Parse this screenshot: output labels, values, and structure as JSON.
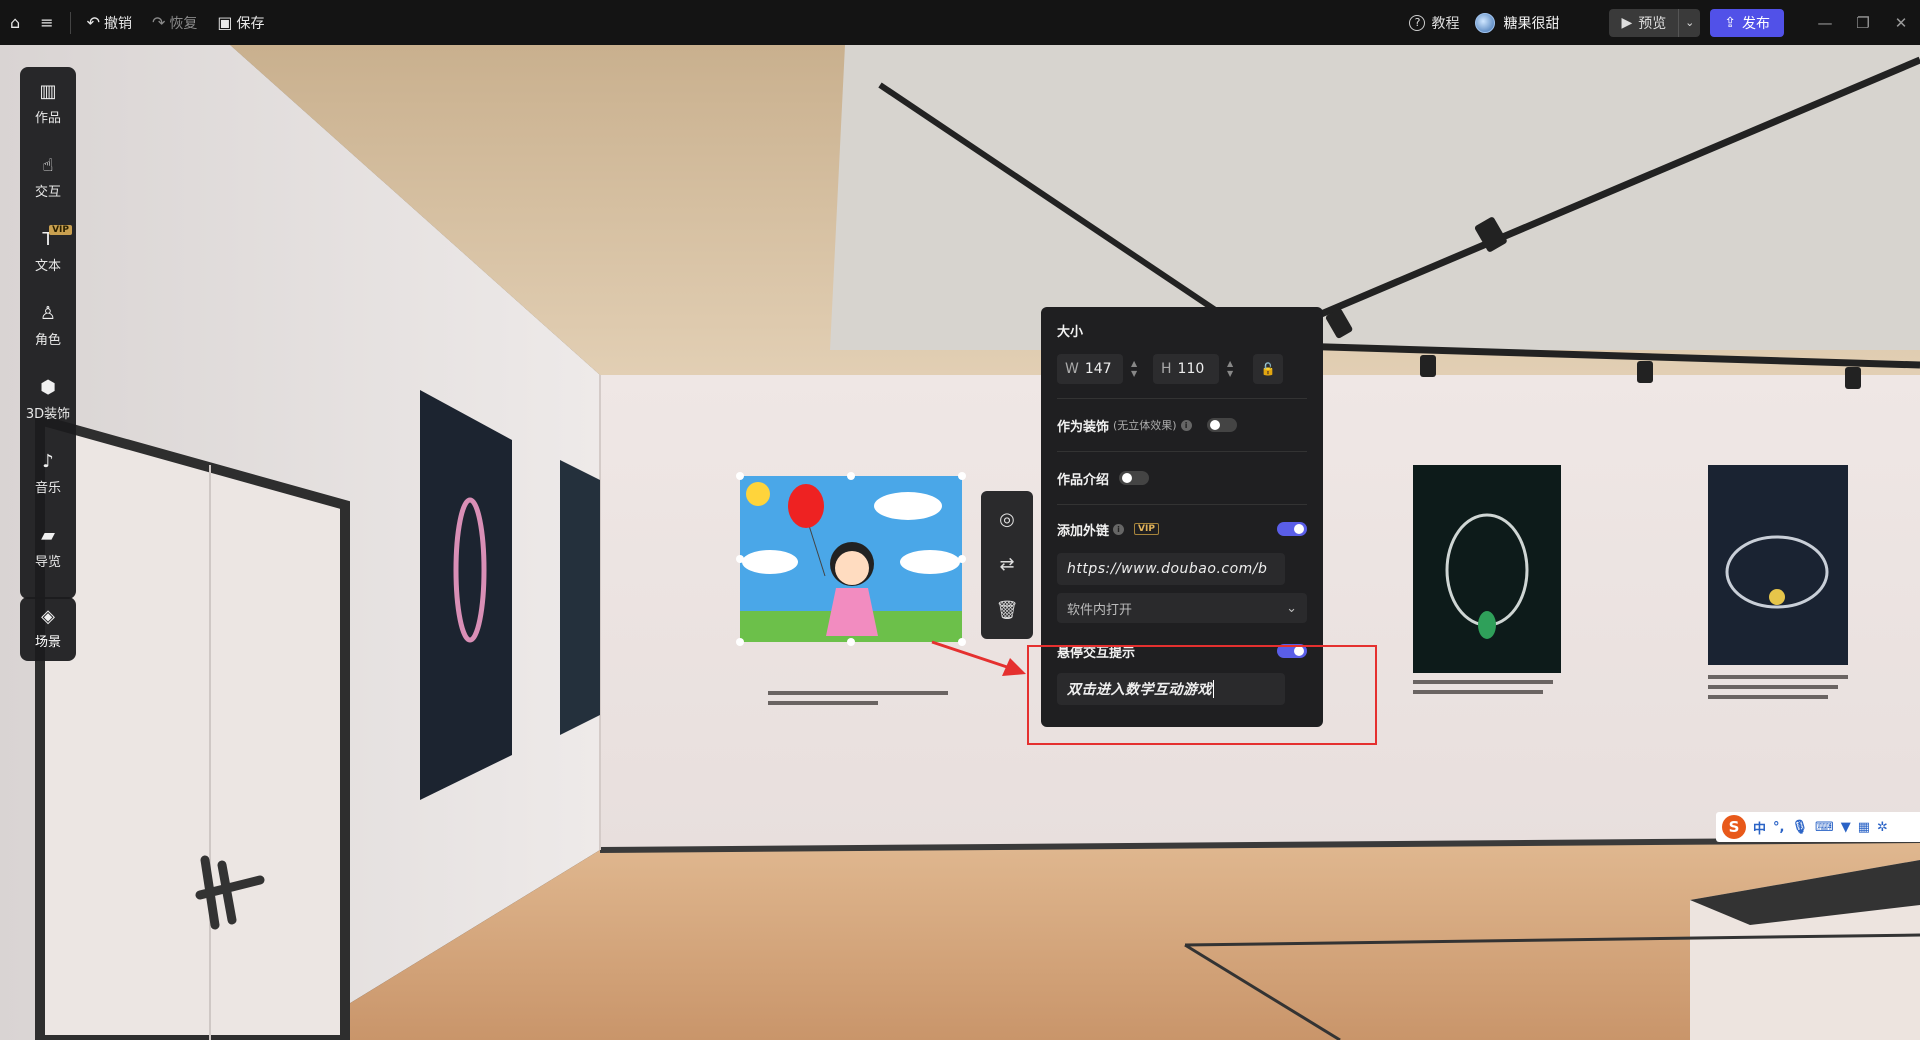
{
  "topbar": {
    "undo": "撤销",
    "redo": "恢复",
    "save": "保存",
    "help": "教程",
    "user": "糖果很甜",
    "preview": "预览",
    "publish": "发布"
  },
  "sidebar": {
    "items": [
      {
        "label": "作品",
        "icon": "artwork-icon"
      },
      {
        "label": "交互",
        "icon": "interaction-icon"
      },
      {
        "label": "文本",
        "icon": "text-icon",
        "badge": "VIP"
      },
      {
        "label": "角色",
        "icon": "character-icon"
      },
      {
        "label": "3D装饰",
        "icon": "cube-icon"
      },
      {
        "label": "音乐",
        "icon": "music-icon"
      },
      {
        "label": "导览",
        "icon": "camera-icon"
      }
    ],
    "scene": "场景"
  },
  "panel": {
    "size_title": "大小",
    "width_label": "W",
    "width": "147",
    "height_label": "H",
    "height": "110",
    "decoration_label": "作为装饰",
    "decoration_note": "(无立体效果)",
    "decoration_on": false,
    "intro_label": "作品介绍",
    "intro_on": false,
    "link_label": "添加外链",
    "link_badge": "VIP",
    "link_on": true,
    "link_url": "https://www.doubao.com/b",
    "open_mode": "软件内打开",
    "hover_label": "悬停交互提示",
    "hover_on": true,
    "hover_text": "双击进入数学互动游戏"
  },
  "ime": {
    "label": "中"
  },
  "colors": {
    "accent": "#5151e8",
    "highlight": "#e5302f"
  }
}
